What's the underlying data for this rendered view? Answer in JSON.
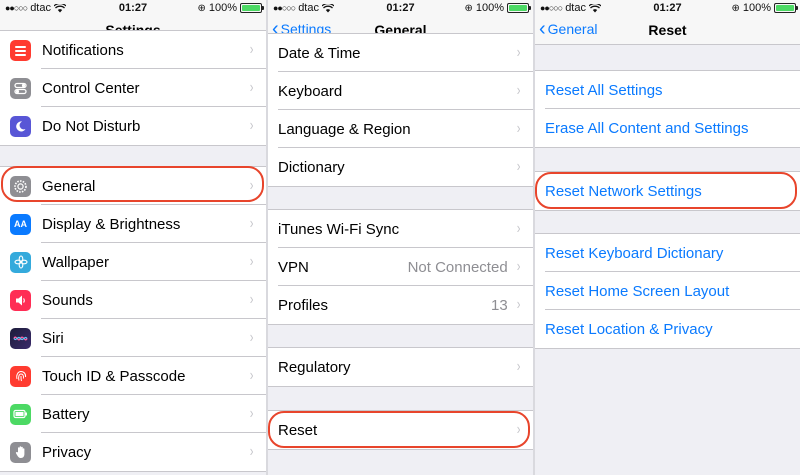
{
  "status": {
    "signal": "●●○○○",
    "carrier": "dtac",
    "time": "01:27",
    "battery_percent": "100%",
    "battery_level": 1.0
  },
  "colors": {
    "accent": "#0a7aff",
    "callout": "#e8452c",
    "battery": "#4cd964"
  },
  "screen1": {
    "title": "Settings",
    "rows": [
      {
        "label": "Notifications",
        "icon": "notifications-icon",
        "color": "#ff3b30"
      },
      {
        "label": "Control Center",
        "icon": "control-center-icon",
        "color": "#8e8e93"
      },
      {
        "label": "Do Not Disturb",
        "icon": "moon-icon",
        "color": "#5856d6"
      },
      {
        "label": "General",
        "icon": "gear-icon",
        "color": "#8e8e93"
      },
      {
        "label": "Display & Brightness",
        "icon": "display-icon",
        "glyph": "AA",
        "color": "#0a7aff"
      },
      {
        "label": "Wallpaper",
        "icon": "wallpaper-icon",
        "color": "#34aadc"
      },
      {
        "label": "Sounds",
        "icon": "speaker-icon",
        "color": "#ff2d55"
      },
      {
        "label": "Siri",
        "icon": "siri-icon",
        "color": "#1c1c3a"
      },
      {
        "label": "Touch ID & Passcode",
        "icon": "fingerprint-icon",
        "color": "#ff3b30"
      },
      {
        "label": "Battery",
        "icon": "battery-icon",
        "color": "#4cd964"
      },
      {
        "label": "Privacy",
        "icon": "hand-icon",
        "color": "#8e8e93"
      }
    ]
  },
  "screen2": {
    "back": "Settings",
    "title": "General",
    "rows": [
      {
        "label": "Date & Time"
      },
      {
        "label": "Keyboard"
      },
      {
        "label": "Language & Region"
      },
      {
        "label": "Dictionary"
      },
      {
        "label": "iTunes Wi-Fi Sync"
      },
      {
        "label": "VPN",
        "value": "Not Connected"
      },
      {
        "label": "Profiles",
        "value": "13"
      },
      {
        "label": "Regulatory"
      },
      {
        "label": "Reset"
      }
    ]
  },
  "screen3": {
    "back": "General",
    "title": "Reset",
    "rows": [
      {
        "label": "Reset All Settings"
      },
      {
        "label": "Erase All Content and Settings"
      },
      {
        "label": "Reset Network Settings"
      },
      {
        "label": "Reset Keyboard Dictionary"
      },
      {
        "label": "Reset Home Screen Layout"
      },
      {
        "label": "Reset Location & Privacy"
      }
    ]
  }
}
